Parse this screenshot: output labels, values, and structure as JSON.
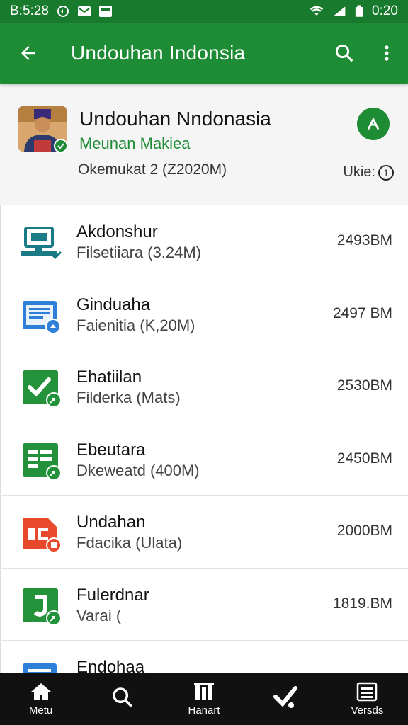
{
  "status_bar": {
    "time_left": "B:5:28",
    "time_right": "0:20",
    "icons": [
      "notification-icon",
      "mail-icon",
      "message-icon",
      "wifi-icon",
      "signal-icon",
      "battery-icon"
    ]
  },
  "app_bar": {
    "title": "Undouhan Indonsia",
    "icons": [
      "back-arrow-icon",
      "search-icon",
      "more-vert-icon"
    ],
    "color": "#1e8b35"
  },
  "header": {
    "title": "Undouhan Nndonasia",
    "subtitle": "Meunan Makiea",
    "meta": "Okemukat 2 (Z2020M)",
    "status_label": "Ukie:",
    "status_icon_text": "1"
  },
  "items": [
    {
      "name": "Akdonshur",
      "detail": "Filsetiiara (3.24M)",
      "size": "2493BM",
      "icon": "computer-icon",
      "color": "#1a7a86"
    },
    {
      "name": "Ginduaha",
      "detail": "Faienitia (K,20M)",
      "size": "2497 BM",
      "icon": "document-icon",
      "color": "#2d7fd8"
    },
    {
      "name": "Ehatiilan",
      "detail": "Filderka (Mats)",
      "size": "2530BM",
      "icon": "checkmark-doc-icon",
      "color": "#23923b"
    },
    {
      "name": "Ebeutara",
      "detail": "Dkeweatd (400M)",
      "size": "2450BM",
      "icon": "spreadsheet-icon",
      "color": "#23923b"
    },
    {
      "name": "Undahan",
      "detail": "Fdacika (Ulata)",
      "size": "2000BM",
      "icon": "slides-icon",
      "color": "#e8492a"
    },
    {
      "name": "Fulerdnar",
      "detail": "Varai (",
      "size": "1819.BM",
      "icon": "letter-j-icon",
      "color": "#23923b"
    },
    {
      "name": "Endohaa",
      "detail": "",
      "size": "",
      "icon": "blue-doc-icon",
      "color": "#2d7fd8"
    }
  ],
  "bottom_nav": [
    {
      "label": "Metu",
      "icon": "home-icon"
    },
    {
      "label": "",
      "icon": "search-icon"
    },
    {
      "label": "Hanart",
      "icon": "bars-icon"
    },
    {
      "label": "",
      "icon": "checkmark-icon"
    },
    {
      "label": "Versds",
      "icon": "list-icon"
    }
  ]
}
